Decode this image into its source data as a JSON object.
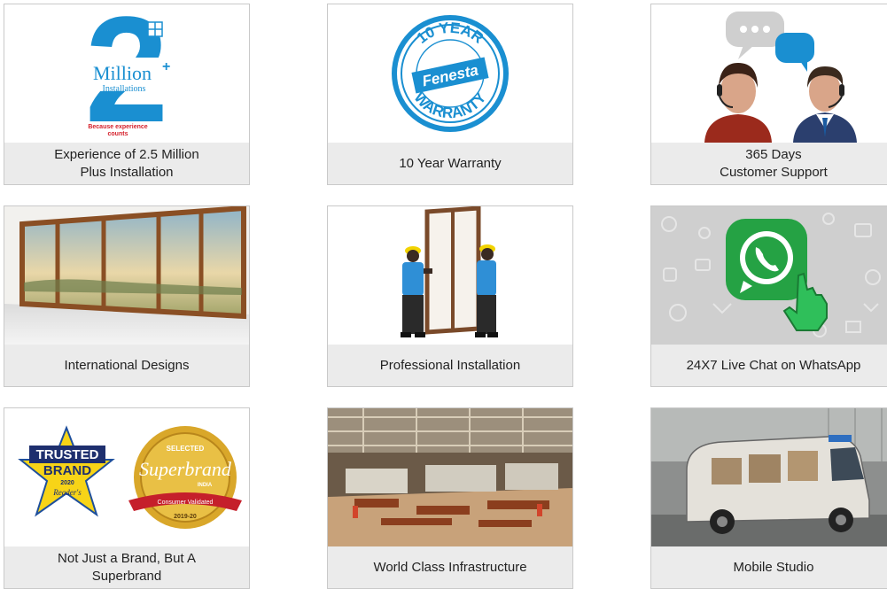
{
  "colors": {
    "caption_bg": "#ebebeb",
    "border": "#c9c9c9",
    "brand_blue": "#1a8fd1",
    "brand_red": "#d5202b",
    "whatsapp_green": "#25a244"
  },
  "cards": [
    {
      "id": "experience",
      "caption": [
        "Experience of 2.5 Million",
        "Plus Installation"
      ],
      "art": {
        "big_text": "2",
        "word": "Million",
        "plus": "+",
        "sub": "Installations",
        "tag1": "Because experience",
        "tag2": "counts"
      }
    },
    {
      "id": "warranty",
      "caption": [
        "10 Year Warranty"
      ],
      "art": {
        "top": "10 YEAR",
        "middle": "Fenesta",
        "bottom": "WARRANTY"
      }
    },
    {
      "id": "support",
      "caption": [
        "365 Days",
        "Customer Support"
      ],
      "art": {
        "icon": "customer-support-icon"
      }
    },
    {
      "id": "designs",
      "caption": [
        "International Designs"
      ],
      "art": {
        "icon": "sliding-window-icon"
      }
    },
    {
      "id": "installation",
      "caption": [
        "Professional Installation"
      ],
      "art": {
        "icon": "installers-icon"
      }
    },
    {
      "id": "whatsapp",
      "caption": [
        "24X7 Live Chat on WhatsApp"
      ],
      "art": {
        "icon": "whatsapp-icon"
      }
    },
    {
      "id": "superbrand",
      "caption": [
        "Not Just a Brand, But A",
        "Superbrand"
      ],
      "art": {
        "b1_top": "TRUSTED",
        "b1_mid": "BRAND",
        "b1_year": "2020",
        "b1_pub": "Reader's",
        "b2_top": "SELECTED",
        "b2_mid": "Superbrand",
        "b2_country": "INDIA",
        "b2_ribbon": "Consumer Validated",
        "b2_year": "2019-20"
      }
    },
    {
      "id": "infrastructure",
      "caption": [
        "World Class Infrastructure"
      ],
      "art": {
        "icon": "factory-icon"
      }
    },
    {
      "id": "studio",
      "caption": [
        "Mobile Studio"
      ],
      "art": {
        "icon": "van-icon"
      }
    }
  ]
}
